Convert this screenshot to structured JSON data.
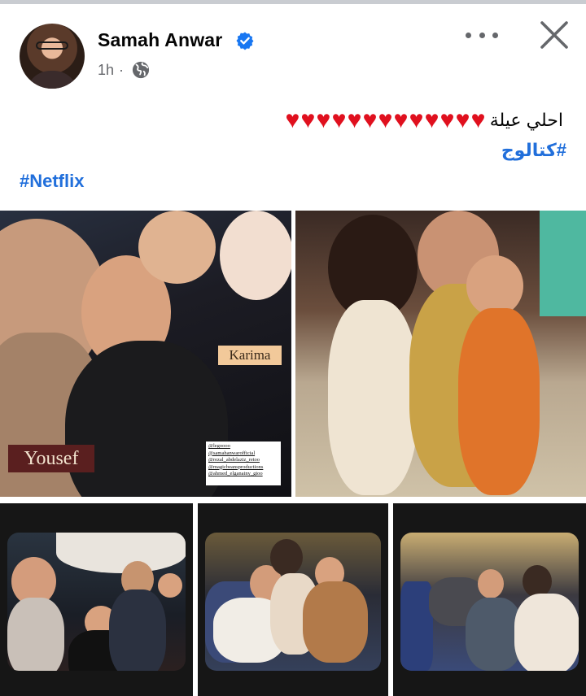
{
  "post": {
    "author": "Samah Anwar",
    "verified_icon": "verified-badge-icon",
    "time": "1h",
    "separator": "·",
    "audience_icon": "globe-icon",
    "text_arabic": "احلي عيلة",
    "hearts": "♥♥♥♥♥♥♥♥♥♥♥♥♥",
    "hashtag_arabic": "#كتالوج",
    "hashtag_netflix": "#Netflix"
  },
  "photos": {
    "photo1": {
      "label_yousef": "Yousef",
      "label_karima": "Karima",
      "credits": [
        "@legoooo",
        "@samahanwarofficial",
        "@rezal_abdelaziz_retoo",
        "@magicbeansproductions",
        "@ahmed_elganainy_gioo"
      ]
    }
  },
  "colors": {
    "link": "#216fdb",
    "heart": "#e0101e",
    "verified": "#1877f2",
    "muted": "#65676b"
  }
}
